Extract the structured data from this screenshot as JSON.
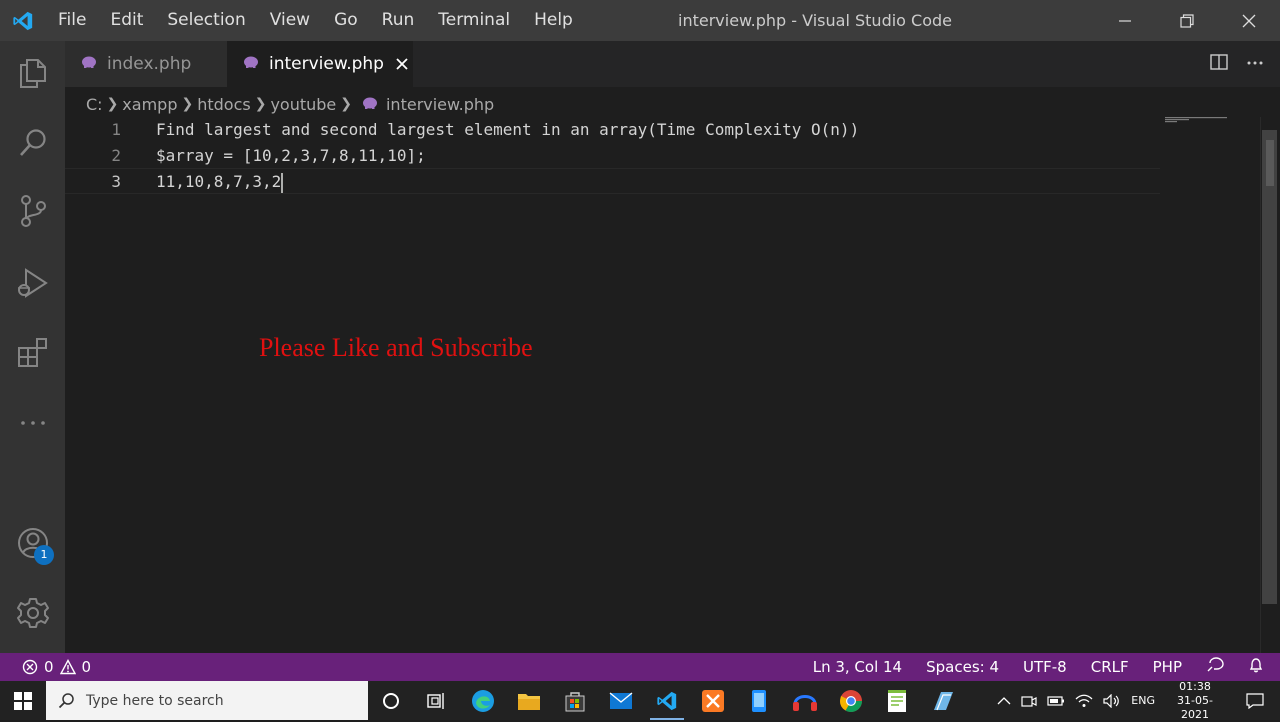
{
  "window": {
    "title": "interview.php - Visual Studio Code",
    "menu": [
      "File",
      "Edit",
      "Selection",
      "View",
      "Go",
      "Run",
      "Terminal",
      "Help"
    ]
  },
  "tabs": [
    {
      "label": "index.php",
      "active": false
    },
    {
      "label": "interview.php",
      "active": true
    }
  ],
  "breadcrumb": [
    "C:",
    "xampp",
    "htdocs",
    "youtube",
    "interview.php"
  ],
  "editor": {
    "lines": [
      {
        "num": "1",
        "text": "Find largest and second largest element in an array(Time Complexity O(n))"
      },
      {
        "num": "2",
        "text": "$array = [10,2,3,7,8,11,10];"
      },
      {
        "num": "3",
        "text": "11,10,8,7,3,2"
      }
    ],
    "current_line": 3
  },
  "overlay": {
    "text": "Please Like and Subscribe",
    "color": "#e01010"
  },
  "activity_bar": {
    "icons": [
      "explorer-icon",
      "search-icon",
      "source-control-icon",
      "run-debug-icon",
      "extensions-icon",
      "more-icon",
      "accounts-icon",
      "settings-gear-icon"
    ],
    "accounts_badge": "1"
  },
  "status": {
    "errors": "0",
    "warnings": "0",
    "position": "Ln 3, Col 14",
    "spaces": "Spaces: 4",
    "encoding": "UTF-8",
    "eol": "CRLF",
    "language": "PHP",
    "bg_color": "#68217a"
  },
  "taskbar": {
    "search_placeholder": "Type here to search",
    "tray_lang": "ENG",
    "time": "01:38",
    "date": "31-05-2021"
  }
}
